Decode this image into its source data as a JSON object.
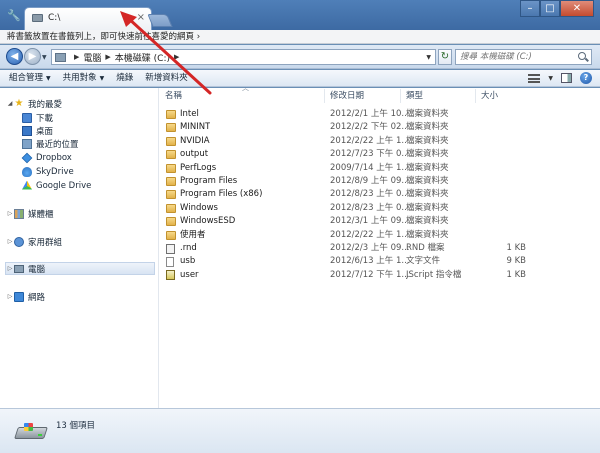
{
  "browser": {
    "tab_title": "C:\\",
    "tab_close": "×",
    "window_controls": [
      "–",
      "□",
      "✕"
    ]
  },
  "bookmarks_bar": {
    "text": "將書籤放置在書籤列上，即可快速前往喜愛的網頁 ›"
  },
  "address": {
    "path": [
      "電腦",
      "本機磁碟 (C:)"
    ],
    "search_placeholder": "搜尋 本機磁碟 (C:)"
  },
  "toolbar": {
    "items": [
      "組合管理",
      "共用對象",
      "燒錄",
      "新增資料夾"
    ]
  },
  "nav": {
    "favorites_label": "我的最愛",
    "favorites": [
      "下載",
      "桌面",
      "最近的位置",
      "Dropbox",
      "SkyDrive",
      "Google Drive"
    ],
    "libraries_label": "媒體櫃",
    "homegroup_label": "家用群組",
    "computer_label": "電腦",
    "network_label": "網路"
  },
  "columns": {
    "name": "名稱",
    "date": "修改日期",
    "type": "類型",
    "size": "大小"
  },
  "files": [
    {
      "name": "Intel",
      "date": "2012/2/1 上午 10...",
      "type": "檔案資料夾",
      "size": "",
      "icon": "folder"
    },
    {
      "name": "MININT",
      "date": "2012/2/2 下午 02...",
      "type": "檔案資料夾",
      "size": "",
      "icon": "folder"
    },
    {
      "name": "NVIDIA",
      "date": "2012/2/22 上午 1...",
      "type": "檔案資料夾",
      "size": "",
      "icon": "folder"
    },
    {
      "name": "output",
      "date": "2012/7/23 下午 0...",
      "type": "檔案資料夾",
      "size": "",
      "icon": "folder"
    },
    {
      "name": "PerfLogs",
      "date": "2009/7/14 上午 1...",
      "type": "檔案資料夾",
      "size": "",
      "icon": "folder"
    },
    {
      "name": "Program Files",
      "date": "2012/8/9 上午 09...",
      "type": "檔案資料夾",
      "size": "",
      "icon": "folder"
    },
    {
      "name": "Program Files (x86)",
      "date": "2012/8/23 上午 0...",
      "type": "檔案資料夾",
      "size": "",
      "icon": "folder"
    },
    {
      "name": "Windows",
      "date": "2012/8/23 上午 0...",
      "type": "檔案資料夾",
      "size": "",
      "icon": "folder"
    },
    {
      "name": "WindowsESD",
      "date": "2012/3/1 上午 09...",
      "type": "檔案資料夾",
      "size": "",
      "icon": "folder"
    },
    {
      "name": "使用者",
      "date": "2012/2/22 上午 1...",
      "type": "檔案資料夾",
      "size": "",
      "icon": "folder"
    },
    {
      "name": ".rnd",
      "date": "2012/2/3 上午 09...",
      "type": "RND 檔案",
      "size": "1 KB",
      "icon": "rnd"
    },
    {
      "name": "usb",
      "date": "2012/6/13 上午 1...",
      "type": "文字文件",
      "size": "9 KB",
      "icon": "file"
    },
    {
      "name": "user",
      "date": "2012/7/12 下午 1...",
      "type": "JScript 指令檔",
      "size": "1 KB",
      "icon": "js"
    }
  ],
  "status": {
    "item_count": "13 個項目"
  },
  "colors": {
    "annotation_arrow": "#d42626",
    "chrome_blue": "#3d6aa3"
  }
}
